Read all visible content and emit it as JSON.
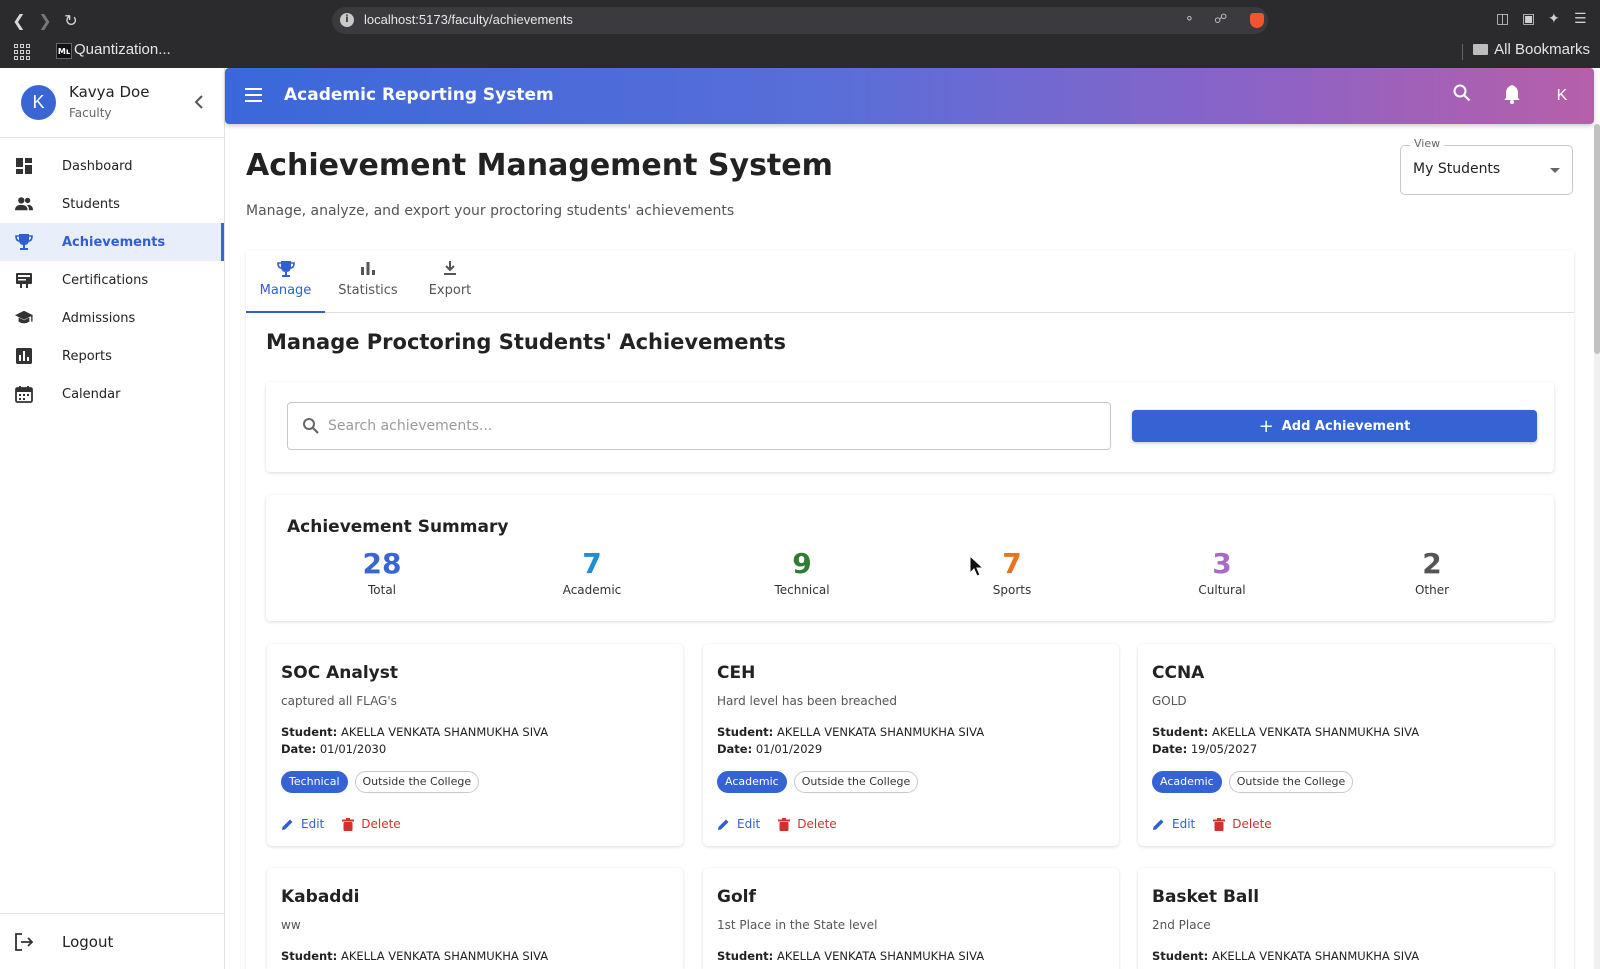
{
  "browser": {
    "url": "localhost:5173/faculty/achievements",
    "bookmark": "Quantization...",
    "bookmark_favicon": "Mʟ",
    "all_bookmarks": "All Bookmarks"
  },
  "user": {
    "initial": "K",
    "name": "Kavya Doe",
    "role": "Faculty"
  },
  "sidebar": {
    "items": [
      {
        "label": "Dashboard",
        "icon": "dashboard-icon"
      },
      {
        "label": "Students",
        "icon": "people-icon"
      },
      {
        "label": "Achievements",
        "icon": "trophy-icon",
        "active": true
      },
      {
        "label": "Certifications",
        "icon": "certificate-icon"
      },
      {
        "label": "Admissions",
        "icon": "school-icon"
      },
      {
        "label": "Reports",
        "icon": "report-chart-icon"
      },
      {
        "label": "Calendar",
        "icon": "calendar-icon"
      }
    ],
    "logout": "Logout"
  },
  "appbar": {
    "title": "Academic Reporting System",
    "avatar_initial": "K"
  },
  "page": {
    "title": "Achievement Management System",
    "subtitle": "Manage, analyze, and export your proctoring students' achievements",
    "view_label": "View",
    "view_value": "My Students"
  },
  "tabs": [
    {
      "label": "Manage",
      "icon": "trophy-icon",
      "active": true
    },
    {
      "label": "Statistics",
      "icon": "bar-chart-icon"
    },
    {
      "label": "Export",
      "icon": "download-icon"
    }
  ],
  "manage": {
    "title": "Manage Proctoring Students' Achievements",
    "search_placeholder": "Search achievements...",
    "add_button": "Add Achievement"
  },
  "summary": {
    "title": "Achievement Summary",
    "stats": [
      {
        "value": "28",
        "label": "Total",
        "color": "#3a66d4"
      },
      {
        "value": "7",
        "label": "Academic",
        "color": "#1f8fd1"
      },
      {
        "value": "9",
        "label": "Technical",
        "color": "#2e7d32"
      },
      {
        "value": "7",
        "label": "Sports",
        "color": "#e8741d"
      },
      {
        "value": "3",
        "label": "Cultural",
        "color": "#a66bc4"
      },
      {
        "value": "2",
        "label": "Other",
        "color": "#555555"
      }
    ]
  },
  "labels": {
    "student": "Student:",
    "date": "Date:",
    "edit": "Edit",
    "delete": "Delete"
  },
  "cards": [
    {
      "title": "SOC Analyst",
      "description": "captured all FLAG's",
      "student": "AKELLA VENKATA SHANMUKHA SIVA",
      "date": "01/01/2030",
      "category": "Technical",
      "location": "Outside the College"
    },
    {
      "title": "CEH",
      "description": "Hard level has been breached",
      "student": "AKELLA VENKATA SHANMUKHA SIVA",
      "date": "01/01/2029",
      "category": "Academic",
      "location": "Outside the College"
    },
    {
      "title": "CCNA",
      "description": "GOLD",
      "student": "AKELLA VENKATA SHANMUKHA SIVA",
      "date": "19/05/2027",
      "category": "Academic",
      "location": "Outside the College"
    },
    {
      "title": "Kabaddi",
      "description": "ww",
      "student": "AKELLA VENKATA SHANMUKHA SIVA"
    },
    {
      "title": "Golf",
      "description": "1st Place in the State level",
      "student": "AKELLA VENKATA SHANMUKHA SIVA"
    },
    {
      "title": "Basket Ball",
      "description": "2nd Place",
      "student": "AKELLA VENKATA SHANMUKHA SIVA"
    }
  ]
}
